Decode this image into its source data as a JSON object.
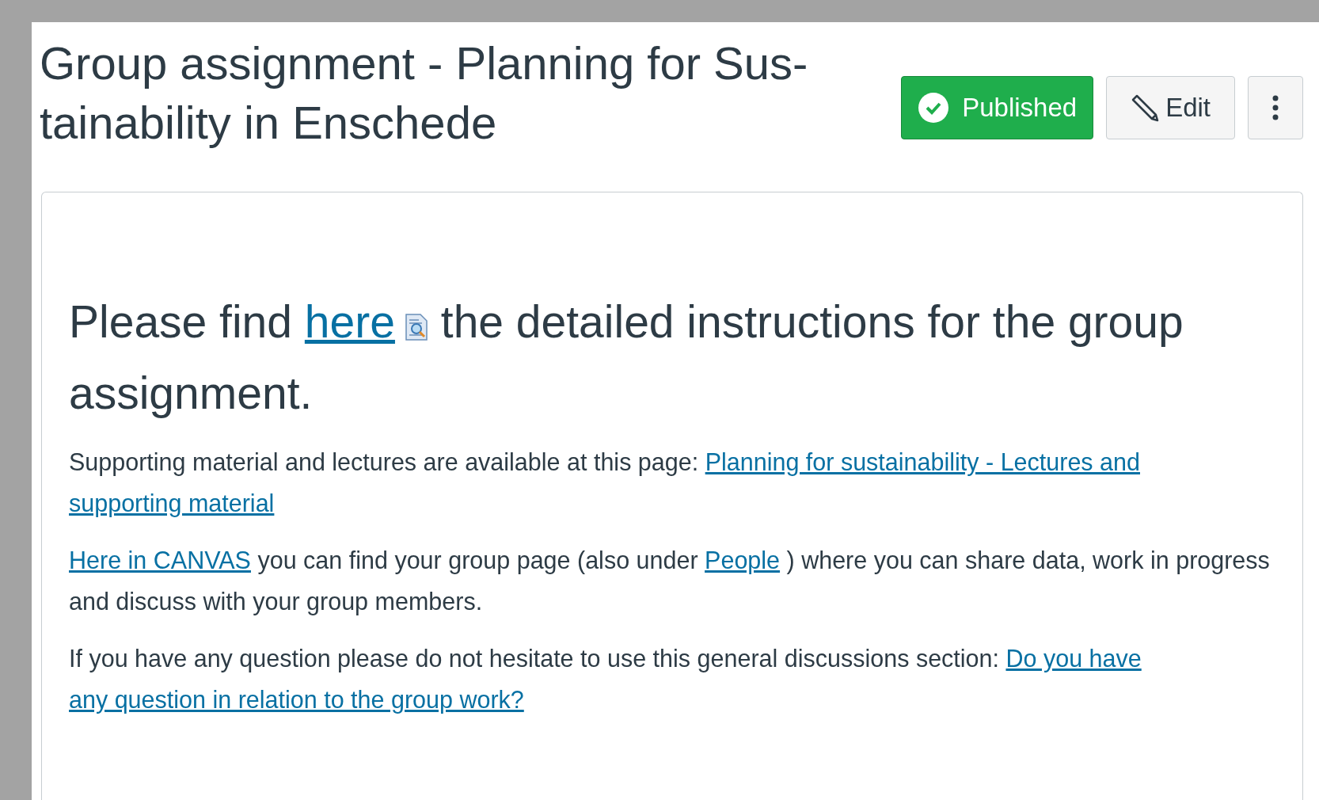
{
  "title": "Group assignment - Planning for Sus-tainability in Enschede",
  "actions": [
    {
      "kind": "status",
      "label": "Published",
      "published": true
    },
    {
      "kind": "edit",
      "label": "Edit"
    },
    {
      "kind": "more"
    }
  ],
  "heading": [
    {
      "kind": "text",
      "text": "Please find "
    },
    {
      "kind": "link",
      "text": "here"
    },
    {
      "kind": "icon"
    },
    {
      "kind": "text",
      "text": " the detailed instructions for the group assignment."
    }
  ],
  "paragraphs": [
    [
      {
        "kind": "text",
        "text": "Supporting material and lectures are available at this page: "
      },
      {
        "kind": "link",
        "text": "Planning for sustainability - Lectures and"
      },
      {
        "kind": "break"
      },
      {
        "kind": "link",
        "text": "supporting material"
      }
    ],
    [
      {
        "kind": "link",
        "text": "Here in CANVAS"
      },
      {
        "kind": "text",
        "text": " you can find your group page (also under "
      },
      {
        "kind": "link",
        "text": "People"
      },
      {
        "kind": "text",
        "text": " ) where you can share data, work in progress and discuss with your group members."
      }
    ],
    [
      {
        "kind": "text",
        "text": "If you have any question please do not hesitate to use this general discussions section: "
      },
      {
        "kind": "link",
        "text": "Do you have"
      },
      {
        "kind": "break"
      },
      {
        "kind": "link",
        "text": "any question in relation to the group work?"
      }
    ]
  ]
}
